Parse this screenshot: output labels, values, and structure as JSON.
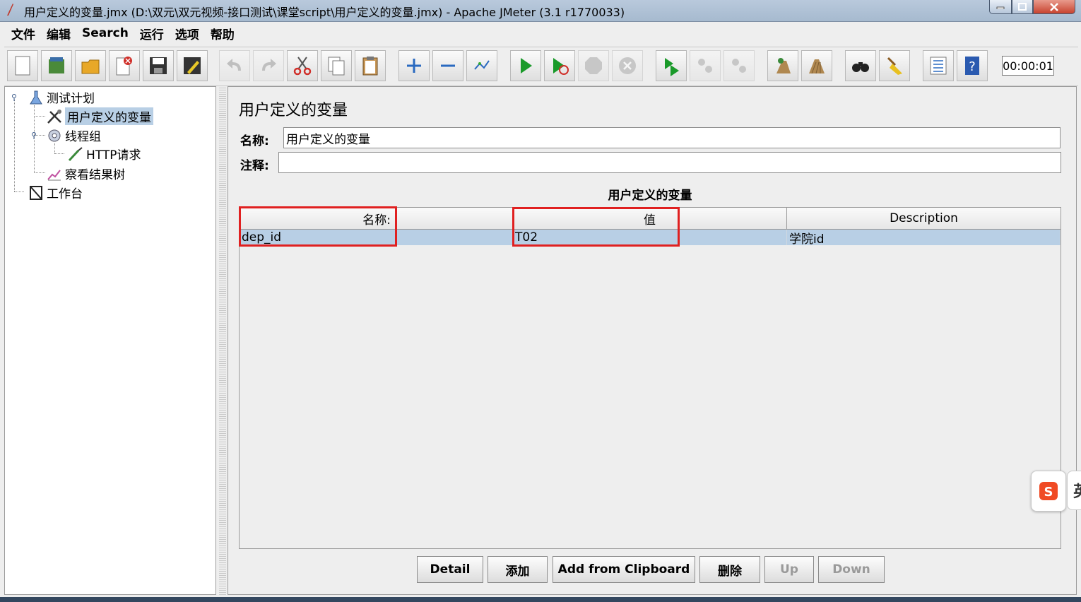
{
  "window": {
    "title": "用户定义的变量.jmx (D:\\双元\\双元视频-接口测试\\课堂script\\用户定义的变量.jmx) - Apache JMeter (3.1 r1770033)"
  },
  "menu": [
    "文件",
    "编辑",
    "Search",
    "运行",
    "选项",
    "帮助"
  ],
  "toolbar": {
    "timer": "00:00:01",
    "icons": [
      "new-icon",
      "templates-icon",
      "open-icon",
      "close-icon",
      "save-icon",
      "save-as-icon",
      "undo-icon",
      "redo-icon",
      "cut-icon",
      "copy-icon",
      "paste-icon",
      "expand-icon",
      "collapse-icon",
      "toggle-icon",
      "start-icon",
      "start-no-pause-icon",
      "stop-icon",
      "shutdown-icon",
      "remote-start-icon",
      "remote-stop-icon",
      "remote-shutdown-icon",
      "clear-icon",
      "clear-all-icon",
      "search-icon",
      "reset-search-icon",
      "function-helper-icon",
      "help-icon"
    ]
  },
  "tree": {
    "items": [
      {
        "label": "测试计划",
        "icon": "test-plan-icon"
      },
      {
        "label": "用户定义的变量",
        "icon": "config-element-icon",
        "selected": true
      },
      {
        "label": "线程组",
        "icon": "thread-group-icon"
      },
      {
        "label": "HTTP请求",
        "icon": "sampler-icon"
      },
      {
        "label": "察看结果树",
        "icon": "listener-icon"
      },
      {
        "label": "工作台",
        "icon": "workbench-icon"
      }
    ]
  },
  "panel": {
    "title": "用户定义的变量",
    "name_label": "名称:",
    "name_value": "用户定义的变量",
    "comment_label": "注释:",
    "comment_value": "",
    "section_title": "用户定义的变量"
  },
  "table": {
    "columns": [
      "名称:",
      "值",
      "Description"
    ],
    "rows": [
      {
        "name": "dep_id",
        "value": "T02",
        "description": "学院id"
      }
    ]
  },
  "buttons": {
    "detail": "Detail",
    "add": "添加",
    "add_clipboard": "Add from Clipboard",
    "delete": "删除",
    "up": "Up",
    "down": "Down"
  },
  "ime": {
    "second_glyph": "英"
  },
  "colors": {
    "selection": "#b8cfe5",
    "highlight": "#e02020"
  }
}
